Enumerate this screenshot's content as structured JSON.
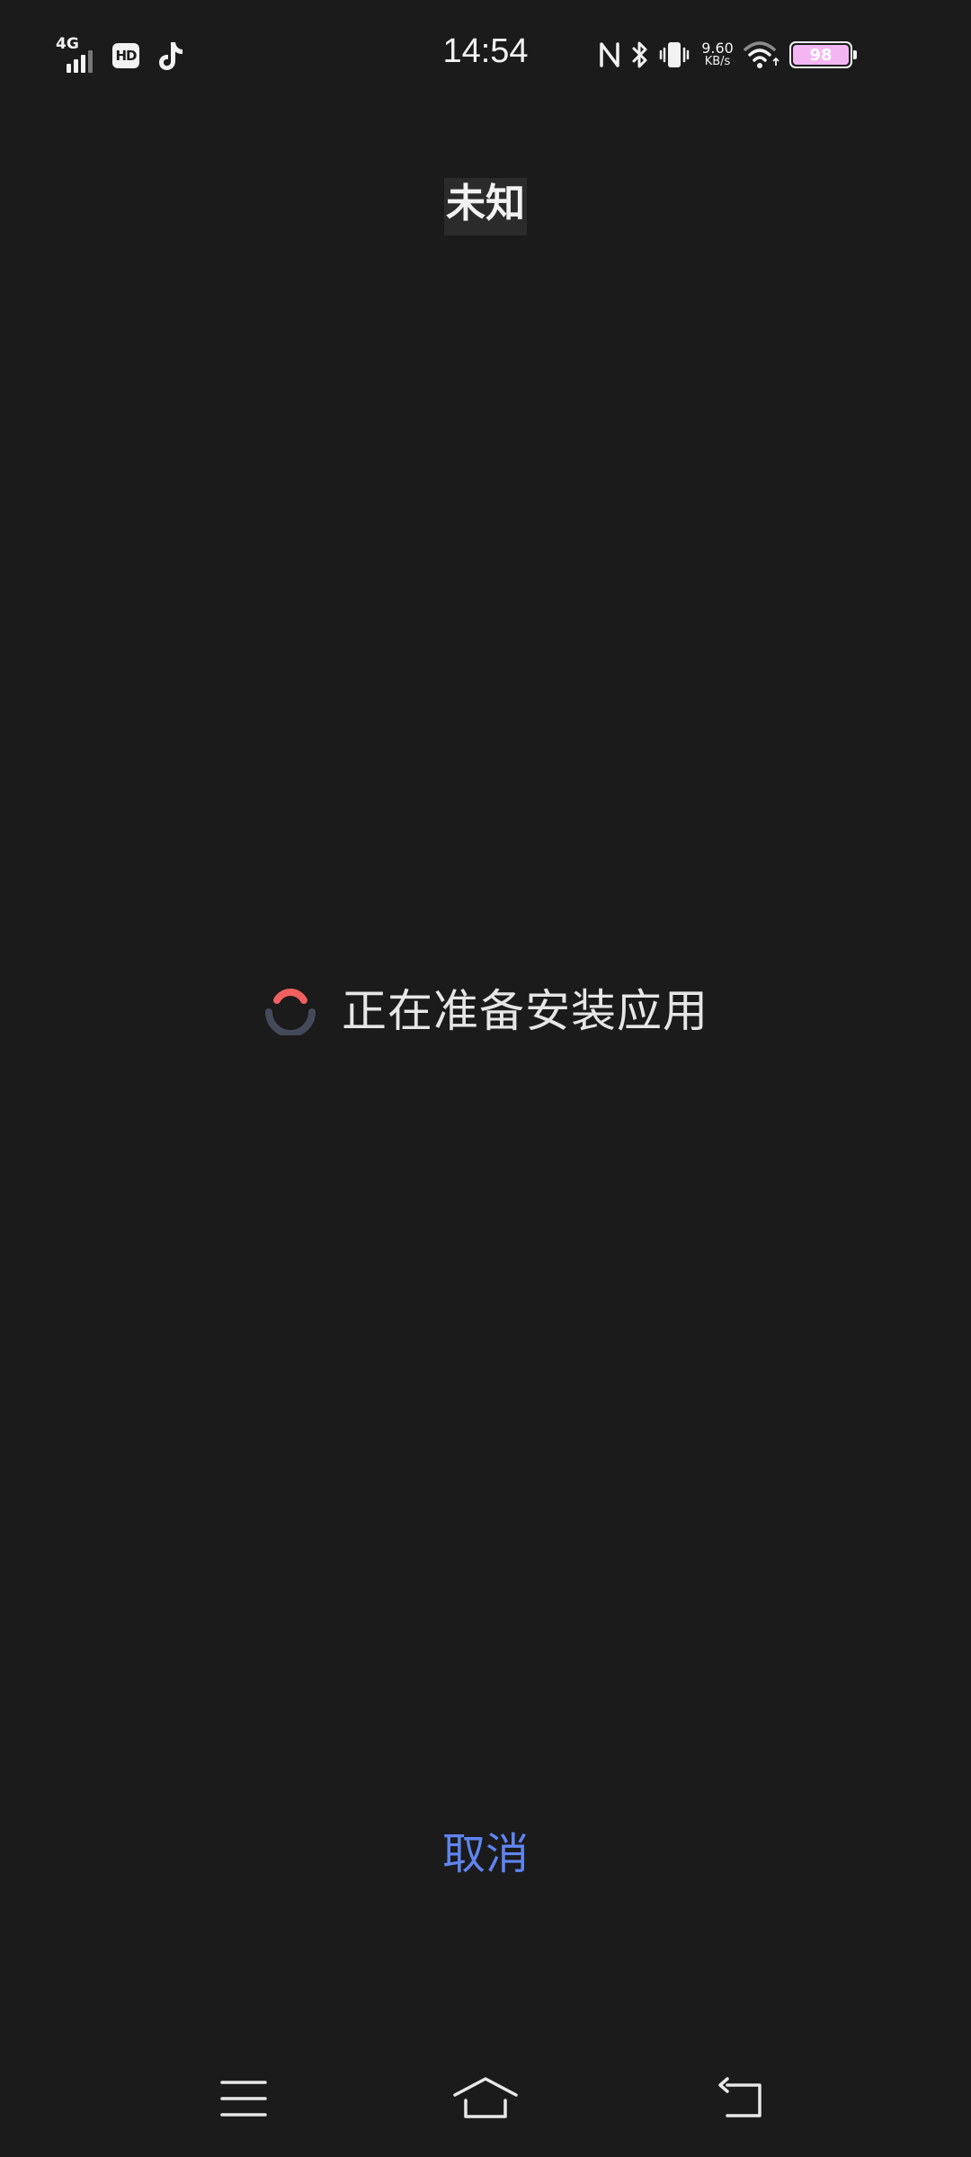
{
  "status_bar": {
    "network_type": "4G",
    "hd_label": "HD",
    "app_icon": "tiktok-icon",
    "time": "14:54",
    "icons": [
      "nfc-icon",
      "bluetooth-icon",
      "vibrate-icon",
      "wifi-icon"
    ],
    "net_speed_value": "9.60",
    "net_speed_unit": "KB/s",
    "battery_level": "98",
    "battery_fill_color": "#f3b6f3"
  },
  "header": {
    "title": "未知"
  },
  "progress": {
    "spinner_icon": "loading-spinner-icon",
    "spinner_colors": [
      "#f0605e",
      "#454a5a"
    ],
    "message": "正在准备安装应用"
  },
  "actions": {
    "cancel_label": "取消",
    "cancel_color": "#5f84f0"
  },
  "nav_bar": {
    "items": [
      "menu-icon",
      "home-icon",
      "back-icon"
    ]
  }
}
